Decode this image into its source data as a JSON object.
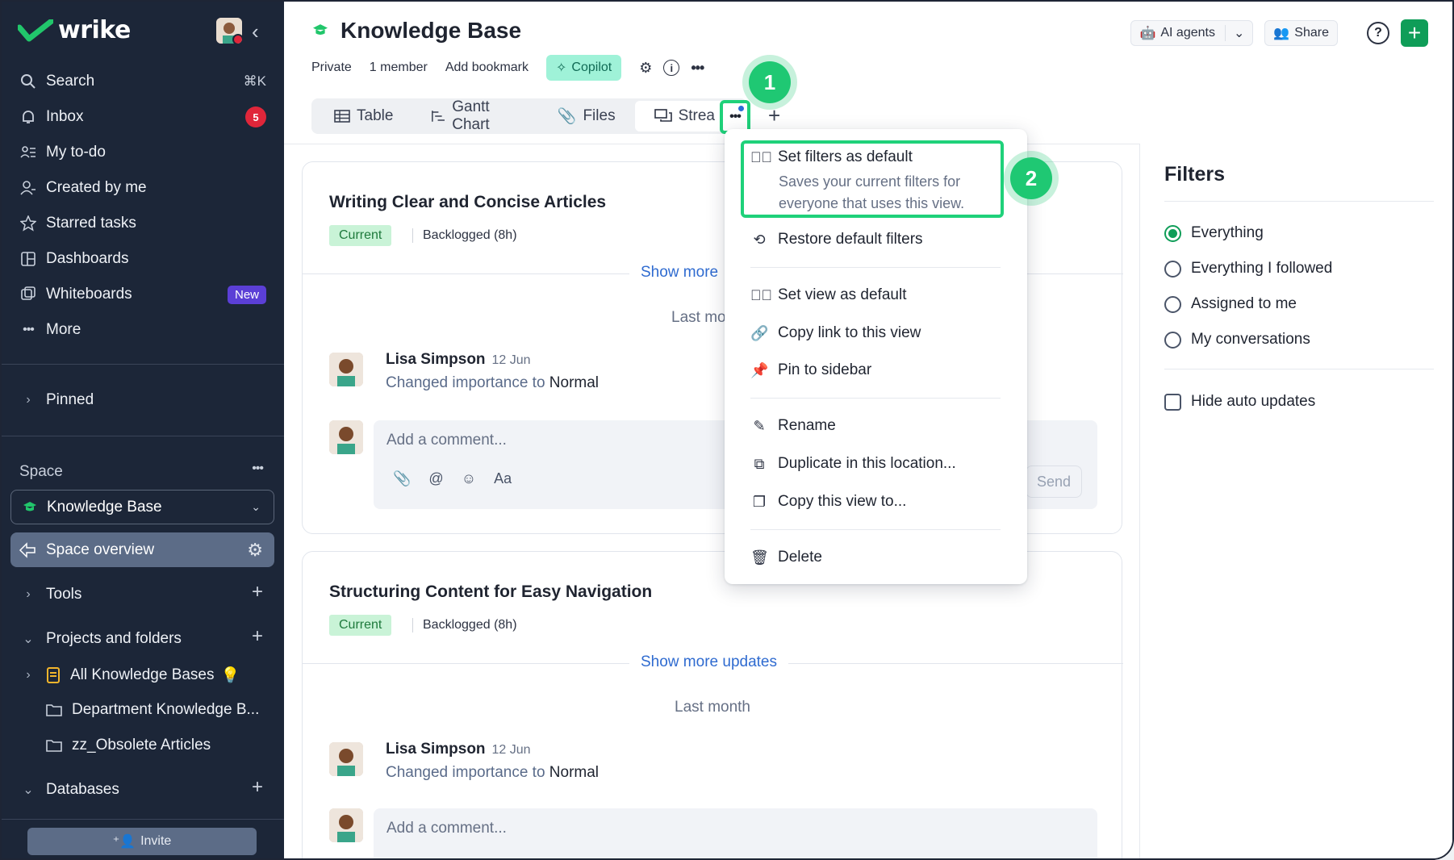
{
  "brand": {
    "name": "wrike"
  },
  "sidebar": {
    "nav": [
      {
        "label": "Search",
        "shortcut": "⌘K",
        "icon": "search-icon"
      },
      {
        "label": "Inbox",
        "badge": "5",
        "icon": "bell-icon"
      },
      {
        "label": "My to-do",
        "icon": "todo-icon"
      },
      {
        "label": "Created by me",
        "icon": "user-icon"
      },
      {
        "label": "Starred tasks",
        "icon": "star-icon"
      },
      {
        "label": "Dashboards",
        "icon": "dashboard-icon"
      },
      {
        "label": "Whiteboards",
        "badge": "New",
        "icon": "whiteboard-icon"
      },
      {
        "label": "More",
        "icon": "more-icon"
      }
    ],
    "pinned": "Pinned",
    "space_header": "Space",
    "space_select": "Knowledge Base",
    "space_overview": "Space overview",
    "tools": "Tools",
    "projects": "Projects and folders",
    "folders": [
      "All Knowledge Bases",
      "Department Knowledge B...",
      "zz_Obsolete Articles"
    ],
    "databases": "Databases",
    "invite": "Invite"
  },
  "header": {
    "title": "Knowledge Base",
    "privacy": "Private",
    "members": "1 member",
    "bookmark": "Add bookmark",
    "copilot": "Copilot",
    "ai_agents": "AI agents",
    "share": "Share"
  },
  "tabs": [
    {
      "label": "Table",
      "icon": "table-icon"
    },
    {
      "label": "Gantt Chart",
      "icon": "gantt-icon"
    },
    {
      "label": "Files",
      "icon": "paperclip-icon"
    },
    {
      "label": "Strea",
      "icon": "stream-icon",
      "active": true
    }
  ],
  "cards": [
    {
      "title": "Writing Clear and Concise Articles",
      "status": "Current",
      "backlog": "Backlogged (8h)",
      "show_more": "Show more",
      "period": "Last mo",
      "author": "Lisa Simpson",
      "date": "12 Jun",
      "change_prefix": "Changed importance to",
      "change_value": "Normal",
      "comment_placeholder": "Add a comment...",
      "send": "Send"
    },
    {
      "title": "Structuring Content for Easy Navigation",
      "status": "Current",
      "backlog": "Backlogged (8h)",
      "show_more": "Show more updates",
      "period": "Last month",
      "author": "Lisa Simpson",
      "date": "12 Jun",
      "change_prefix": "Changed importance to",
      "change_value": "Normal",
      "comment_placeholder": "Add a comment..."
    }
  ],
  "filters": {
    "title": "Filters",
    "options": [
      {
        "label": "Everything",
        "selected": true
      },
      {
        "label": "Everything I followed",
        "selected": false
      },
      {
        "label": "Assigned to me",
        "selected": false
      },
      {
        "label": "My conversations",
        "selected": false
      }
    ],
    "hide_auto": "Hide auto updates"
  },
  "menu": {
    "set_filters": "Set filters as default",
    "set_filters_desc": "Saves your current filters for everyone that uses this view.",
    "restore": "Restore default filters",
    "set_view": "Set view as default",
    "copy_link": "Copy link to this view",
    "pin": "Pin to sidebar",
    "rename": "Rename",
    "duplicate": "Duplicate in this location...",
    "copy_view": "Copy this view to...",
    "delete": "Delete"
  },
  "steps": [
    "1",
    "2"
  ],
  "colors": {
    "accent": "#0f9d58",
    "highlight": "#1fd17a",
    "sidebar": "#1c2638",
    "link": "#2f6bd0"
  }
}
